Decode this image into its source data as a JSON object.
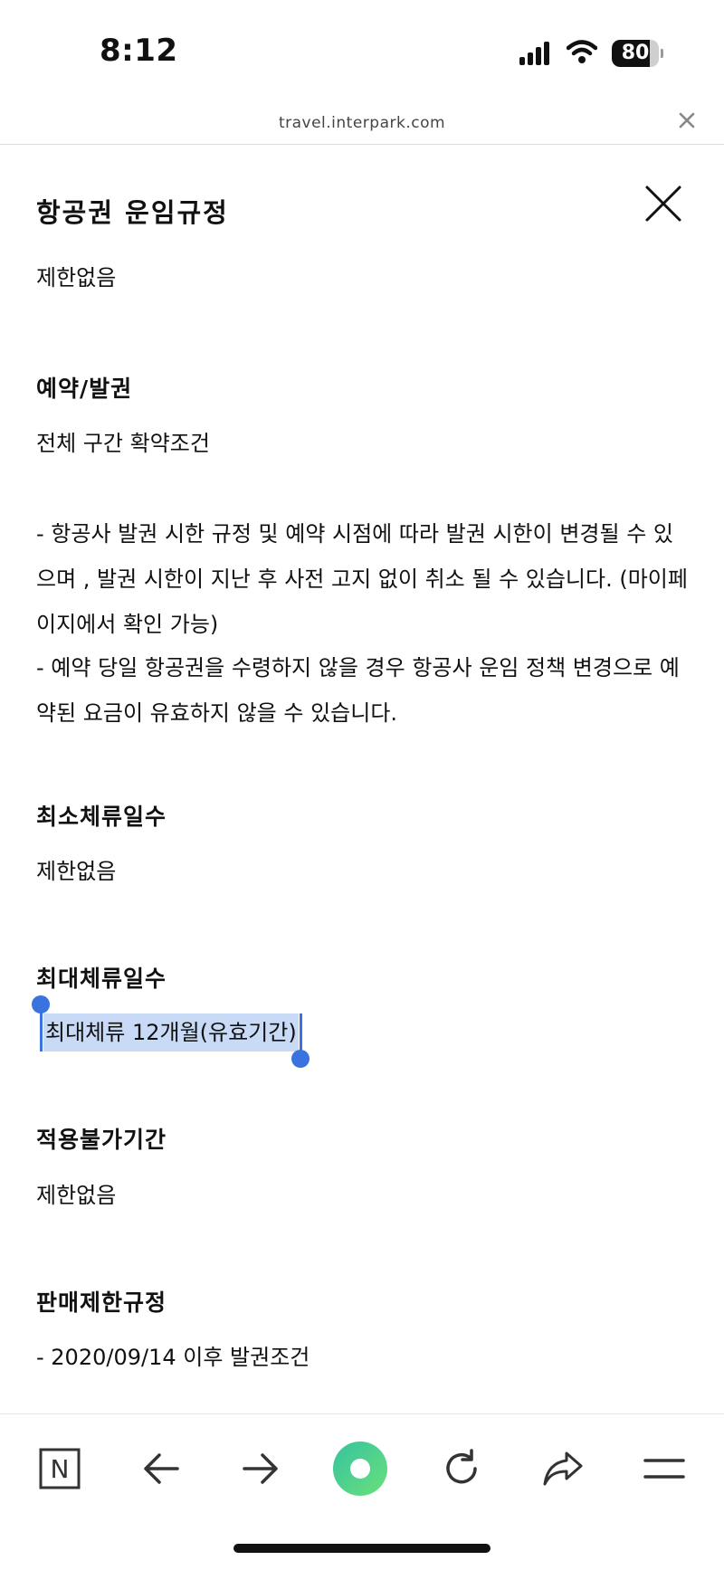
{
  "status": {
    "time": "8:12",
    "battery": "80",
    "battery_level": 0.8
  },
  "browser": {
    "url": "travel.interpark.com"
  },
  "modal": {
    "title": "항공권 운임규정"
  },
  "sections": {
    "top_value": "제한없음",
    "booking": {
      "heading": "예약/발권",
      "line1": "전체 구간 확약조건",
      "para1": "- 항공사 발권 시한 규정 및 예약 시점에 따라 발권 시한이 변경될 수 있으며 , 발권 시한이 지난 후 사전 고지 없이 취소 될 수 있습니다. (마이페이지에서 확인 가능)",
      "para2": "- 예약 당일 항공권을 수령하지 않을 경우 항공사 운임 정책 변경으로 예약된 요금이 유효하지 않을 수 있습니다."
    },
    "min_stay": {
      "heading": "최소체류일수",
      "value": "제한없음"
    },
    "max_stay": {
      "heading": "최대체류일수",
      "value": "최대체류 12개월(유효기간)"
    },
    "blackout": {
      "heading": "적용불가기간",
      "value": "제한없음"
    },
    "sales": {
      "heading": "판매제한규정",
      "value": "- 2020/09/14 이후 발권조건"
    }
  },
  "colors": {
    "selection": "#c9daf6",
    "handle": "#3a73e0",
    "naver_green": "#4ad18b"
  },
  "toolbar": {
    "icons": [
      "naver-n-icon",
      "back-arrow-icon",
      "forward-arrow-icon",
      "green-dot-icon",
      "refresh-icon",
      "share-icon",
      "menu-icon"
    ],
    "n_label": "N"
  }
}
